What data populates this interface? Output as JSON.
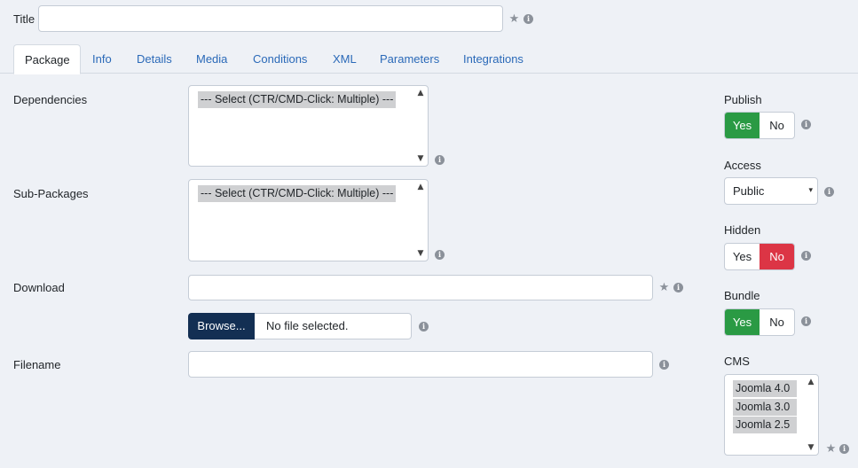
{
  "title_field": {
    "label": "Title",
    "value": ""
  },
  "tabs": [
    {
      "label": "Package"
    },
    {
      "label": "Info"
    },
    {
      "label": "Details"
    },
    {
      "label": "Media"
    },
    {
      "label": "Conditions"
    },
    {
      "label": "XML"
    },
    {
      "label": "Parameters"
    },
    {
      "label": "Integrations"
    }
  ],
  "active_tab": "Package",
  "dependencies": {
    "label": "Dependencies",
    "option": "--- Select (CTR/CMD-Click: Multiple) ---"
  },
  "sub_packages": {
    "label": "Sub-Packages",
    "option": "--- Select (CTR/CMD-Click: Multiple) ---"
  },
  "download": {
    "label": "Download",
    "value": "",
    "browse_label": "Browse...",
    "file_status": "No file selected."
  },
  "filename": {
    "label": "Filename",
    "value": ""
  },
  "publish": {
    "label": "Publish",
    "yes": "Yes",
    "no": "No",
    "selected": "Yes"
  },
  "access": {
    "label": "Access",
    "value": "Public"
  },
  "hidden": {
    "label": "Hidden",
    "yes": "Yes",
    "no": "No",
    "selected": "No"
  },
  "bundle": {
    "label": "Bundle",
    "yes": "Yes",
    "no": "No",
    "selected": "Yes"
  },
  "cms": {
    "label": "CMS",
    "options": [
      "Joomla 4.0",
      "Joomla 3.0",
      "Joomla 2.5"
    ]
  },
  "colors": {
    "accent": "#2a69b8",
    "yes_green": "#2a9a44",
    "no_red": "#dc3545",
    "browse_bg": "#132f53"
  },
  "icons": {
    "info": "info-icon",
    "required": "star-icon"
  }
}
